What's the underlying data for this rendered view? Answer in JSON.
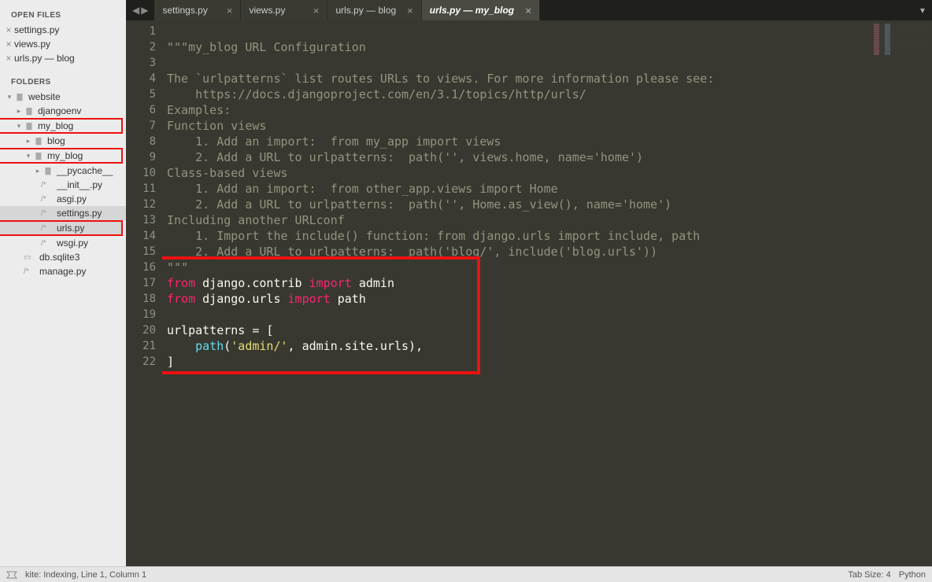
{
  "sidebar": {
    "open_files_title": "OPEN FILES",
    "open_files": [
      {
        "label": "settings.py"
      },
      {
        "label": "views.py"
      },
      {
        "label": "urls.py — blog"
      }
    ],
    "folders_title": "FOLDERS",
    "tree": {
      "website": "website",
      "djangoenv": "djangoenv",
      "my_blog_outer": "my_blog",
      "blog": "blog",
      "my_blog_inner": "my_blog",
      "pycache": "__pycache__",
      "init_py": "__init__.py",
      "asgi_py": "asgi.py",
      "settings_py": "settings.py",
      "urls_py": "urls.py",
      "wsgi_py": "wsgi.py",
      "db_sqlite3": "db.sqlite3",
      "manage_py": "manage.py"
    }
  },
  "tabs": {
    "items": [
      {
        "label": "settings.py",
        "active": false
      },
      {
        "label": "views.py",
        "active": false
      },
      {
        "label": "urls.py — blog",
        "active": false
      },
      {
        "label": "urls.py — my_blog",
        "active": true
      }
    ]
  },
  "code_lines": {
    "l1": "\"\"\"my_blog URL Configuration",
    "l2": "",
    "l3": "The `urlpatterns` list routes URLs to views. For more information please see:",
    "l4": "    https://docs.djangoproject.com/en/3.1/topics/http/urls/",
    "l5": "Examples:",
    "l6": "Function views",
    "l7": "    1. Add an import:  from my_app import views",
    "l8": "    2. Add a URL to urlpatterns:  path('', views.home, name='home')",
    "l9": "Class-based views",
    "l10": "    1. Add an import:  from other_app.views import Home",
    "l11": "    2. Add a URL to urlpatterns:  path('', Home.as_view(), name='home')",
    "l12": "Including another URLconf",
    "l13": "    1. Import the include() function: from django.urls import include, path",
    "l14": "    2. Add a URL to urlpatterns:  path('blog/', include('blog.urls'))",
    "l15": "\"\"\"",
    "l16": {
      "from": "from",
      "mod1": "django.contrib",
      "imp": "import",
      "name1": "admin"
    },
    "l17": {
      "from": "from",
      "mod1": "django.urls",
      "imp": "import",
      "name1": "path"
    },
    "l18": "",
    "l19": {
      "var": "urlpatterns",
      "eq": " = [",
      "full": "urlpatterns = ["
    },
    "l20": {
      "indent": "    ",
      "fn": "path",
      "open": "(",
      "str": "'admin/'",
      "rest": ", admin.site.urls),"
    },
    "l21": "]",
    "l22": ""
  },
  "line_numbers": [
    "1",
    "2",
    "3",
    "4",
    "5",
    "6",
    "7",
    "8",
    "9",
    "10",
    "11",
    "12",
    "13",
    "14",
    "15",
    "16",
    "17",
    "18",
    "19",
    "20",
    "21",
    "22"
  ],
  "status": {
    "kite": "kite: Indexing, Line 1, Column 1",
    "tab_size": "Tab Size: 4",
    "lang": "Python"
  }
}
